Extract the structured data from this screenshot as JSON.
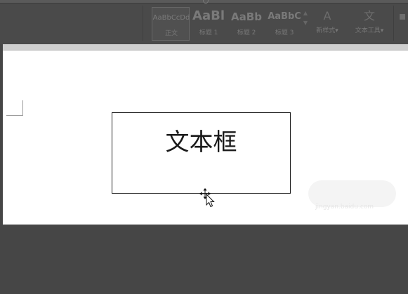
{
  "ribbon": {
    "styles": [
      {
        "sample": "AaBbCcDd",
        "name": "正文",
        "selected": true
      },
      {
        "sample": "AaBl",
        "name": "标题 1",
        "selected": false
      },
      {
        "sample": "AaBb",
        "name": "标题 2",
        "selected": false
      },
      {
        "sample": "AaBbC",
        "name": "标题 3",
        "selected": false
      }
    ],
    "new_style_label": "新样式",
    "text_tools_label": "文本工具",
    "new_style_icon": "A",
    "text_tools_icon": "文"
  },
  "document": {
    "text_box_content": "文本框"
  },
  "watermark": {
    "text": "jingyan.baidu.com"
  }
}
